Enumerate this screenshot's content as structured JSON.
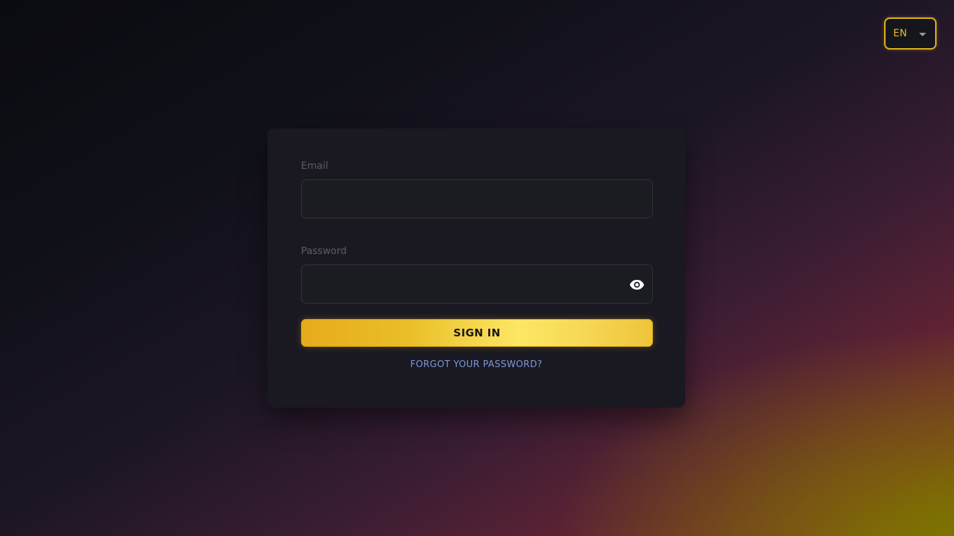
{
  "language_selector": {
    "value": "EN",
    "icon": "chevron-down-icon"
  },
  "login_form": {
    "email": {
      "label": "Email",
      "value": ""
    },
    "password": {
      "label": "Password",
      "value": "",
      "toggle_icon": "eye-icon"
    },
    "sign_in_label": "SIGN IN",
    "forgot_password_label": "FORGOT YOUR PASSWORD?"
  },
  "colors": {
    "accent": "#f0bd1f",
    "link": "#7d98dc",
    "card_background": "#1a1921"
  }
}
